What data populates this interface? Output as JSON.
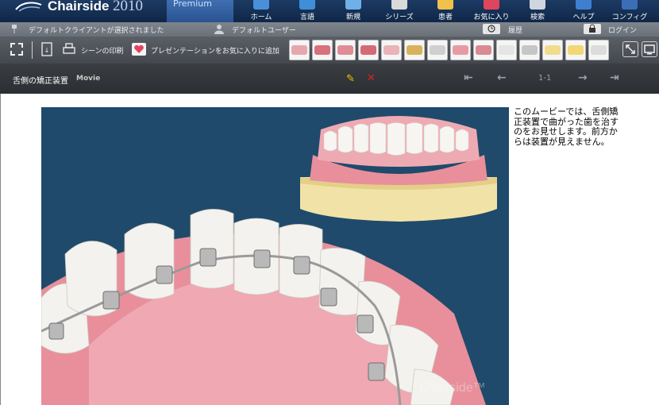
{
  "app": {
    "name": "Chairside",
    "year": "2010",
    "edition": "Premium"
  },
  "nav": [
    {
      "label": "ホーム",
      "icon": "home-icon",
      "color": "#4a90d9"
    },
    {
      "label": "言語",
      "icon": "globe-icon",
      "color": "#3f8fd6"
    },
    {
      "label": "新規",
      "icon": "new-icon",
      "color": "#6fb0e8"
    },
    {
      "label": "シリーズ",
      "icon": "film-icon",
      "color": "#d9d9d9"
    },
    {
      "label": "患者",
      "icon": "patient-icon",
      "color": "#f0c14b"
    },
    {
      "label": "お気に入り",
      "icon": "heart-icon",
      "color": "#e0455e"
    },
    {
      "label": "検索",
      "icon": "search-icon",
      "color": "#cfd6e0"
    },
    {
      "label": "ヘルプ",
      "icon": "help-icon",
      "color": "#3f7fd0"
    },
    {
      "label": "コンフィグ",
      "icon": "gear-icon",
      "color": "#3a6fb5"
    }
  ],
  "status": {
    "client": "デフォルトクライアントが選択されました",
    "user": "デフォルトユーザー",
    "history": "履歴",
    "login": "ログイン"
  },
  "toolbar": {
    "print_scene": "シーンの印刷",
    "add_favorite": "プレゼンテーションをお気に入りに追加",
    "thumbnails": [
      {
        "name": "thumb-1",
        "color": "#e7a6ad"
      },
      {
        "name": "thumb-2",
        "color": "#d9707c"
      },
      {
        "name": "thumb-3",
        "color": "#e08c95"
      },
      {
        "name": "thumb-4",
        "color": "#d56a76"
      },
      {
        "name": "thumb-5",
        "color": "#e9b3b8"
      },
      {
        "name": "thumb-6",
        "color": "#d8b15a"
      },
      {
        "name": "thumb-7",
        "color": "#cfcfcf"
      },
      {
        "name": "thumb-8",
        "color": "#e79aa3"
      },
      {
        "name": "thumb-9",
        "color": "#d98a93"
      },
      {
        "name": "thumb-10",
        "color": "#e5e5e5"
      },
      {
        "name": "thumb-11",
        "color": "#c6c6c6"
      },
      {
        "name": "thumb-12",
        "color": "#f0dc8c"
      },
      {
        "name": "thumb-13",
        "color": "#f2d774"
      },
      {
        "name": "thumb-14",
        "color": "#dcdcdc"
      }
    ]
  },
  "title": {
    "text": "舌側の矯正装置",
    "tag": "Movie",
    "page": "1-1"
  },
  "description": "このムービーでは、舌側矯正装置で曲がった歯を治すのをお見せします。前方からは装置が見えません。",
  "watermark": "Chairside™",
  "colors": {
    "movie_bg": "#1f4a6b",
    "gum": "#e88f9b",
    "tooth": "#f4f2ee",
    "base": "#f1e3a8"
  }
}
